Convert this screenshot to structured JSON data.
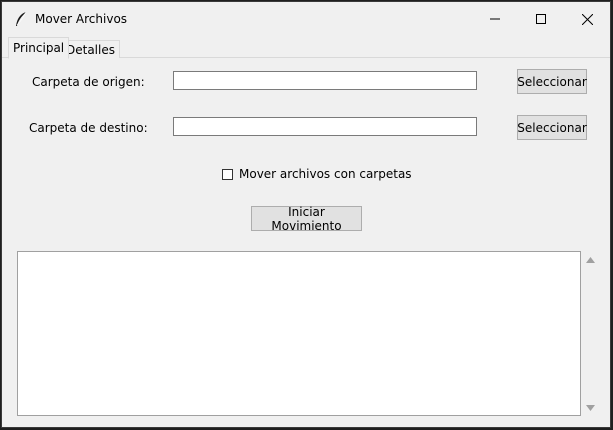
{
  "window": {
    "title": "Mover Archivos",
    "app_icon": "feather-icon"
  },
  "tabs": [
    {
      "label": "Principal",
      "active": true
    },
    {
      "label": "Detalles",
      "active": false
    }
  ],
  "source": {
    "label": "Carpeta de origen:",
    "value": "",
    "button_label": "Seleccionar"
  },
  "destination": {
    "label": "Carpeta de destino:",
    "value": "",
    "button_label": "Seleccionar"
  },
  "options": {
    "move_with_folders_label": "Mover archivos con carpetas",
    "move_with_folders_checked": false
  },
  "actions": {
    "start_label": "Iniciar Movimiento"
  },
  "log": {
    "content": ""
  },
  "colors": {
    "window_bg": "#f0f0f0",
    "button_bg": "#e1e1e1",
    "button_border": "#adadad"
  }
}
